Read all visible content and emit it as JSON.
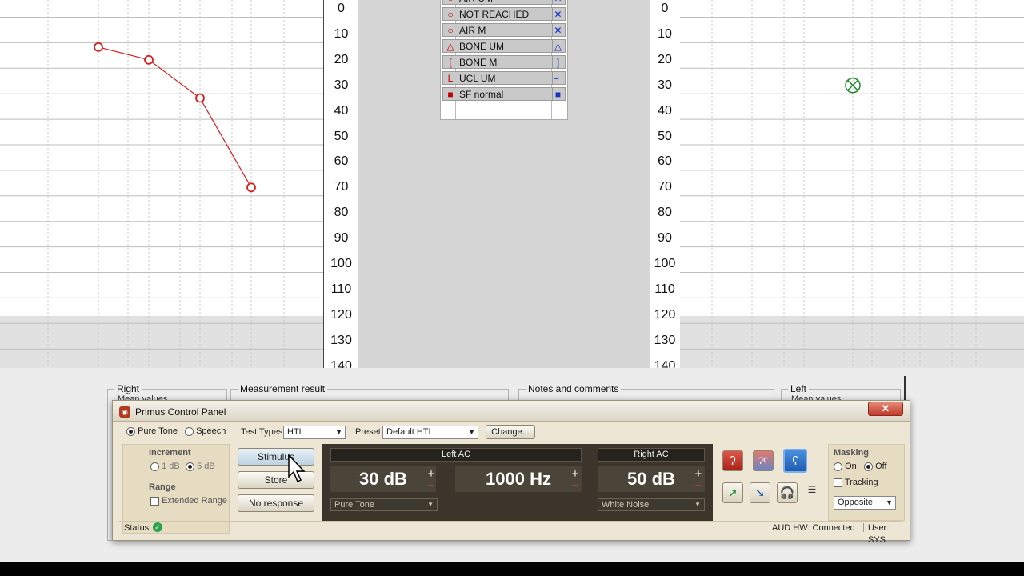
{
  "charts": {
    "scale_labels": [
      "0",
      "10",
      "20",
      "30",
      "40",
      "50",
      "60",
      "70",
      "80",
      "90",
      "100",
      "110",
      "120",
      "130",
      "140"
    ]
  },
  "right_chart": {
    "points": [
      {
        "x_index": 0,
        "db": 15
      },
      {
        "x_index": 1,
        "db": 20
      },
      {
        "x_index": 2,
        "db": 35
      },
      {
        "x_index": 3,
        "db": 70
      }
    ],
    "color": "#d81e1e"
  },
  "left_chart": {
    "marker": {
      "x_index": 3,
      "db": 30
    },
    "color": "#1e8a2e"
  },
  "legend": {
    "items": [
      {
        "label": "AIR UM",
        "left_symbol": "○",
        "right_symbol": "✕"
      },
      {
        "label": "NOT REACHED",
        "left_symbol": "○",
        "right_symbol": "✕"
      },
      {
        "label": "AIR M",
        "left_symbol": "○",
        "right_symbol": "✕"
      },
      {
        "label": "BONE UM",
        "left_symbol": "△",
        "right_symbol": "△"
      },
      {
        "label": "BONE M",
        "left_symbol": "[",
        "right_symbol": "]"
      },
      {
        "label": "UCL UM",
        "left_symbol": "L",
        "right_symbol": "┘"
      },
      {
        "label": "SF normal",
        "left_symbol": "■",
        "right_symbol": "■"
      }
    ]
  },
  "sections": {
    "right": "Right",
    "measurement": "Measurement result",
    "notes": "Notes and comments",
    "left": "Left",
    "mean_values": "Mean values"
  },
  "panel": {
    "title": "Primus Control Panel",
    "close": "✕",
    "mode_pure_tone": "Pure Tone",
    "mode_speech": "Speech",
    "test_types_label": "Test Types",
    "test_types_value": "HTL",
    "preset_label": "Preset",
    "preset_value": "Default HTL",
    "change_button": "Change...",
    "increment_label": "Increment",
    "inc_1": "1 dB",
    "inc_5": "5 dB",
    "range_label": "Range",
    "extended_range": "Extended Range",
    "stimulus_button": "Stimulus",
    "store_button": "Store",
    "no_response_button": "No response",
    "left_ac_header": "Left AC",
    "right_ac_header": "Right AC",
    "left_level": "30 dB",
    "frequency": "1000 Hz",
    "right_level": "50 dB",
    "left_signal": "Pure Tone",
    "right_signal": "White Noise",
    "masking_label": "Masking",
    "masking_on": "On",
    "masking_off": "Off",
    "tracking": "Tracking",
    "masking_mode": "Opposite",
    "status_label": "Status",
    "aud_hw": "AUD HW:  Connected",
    "user": "User: SYS",
    "plus": "+",
    "minus": "−"
  }
}
